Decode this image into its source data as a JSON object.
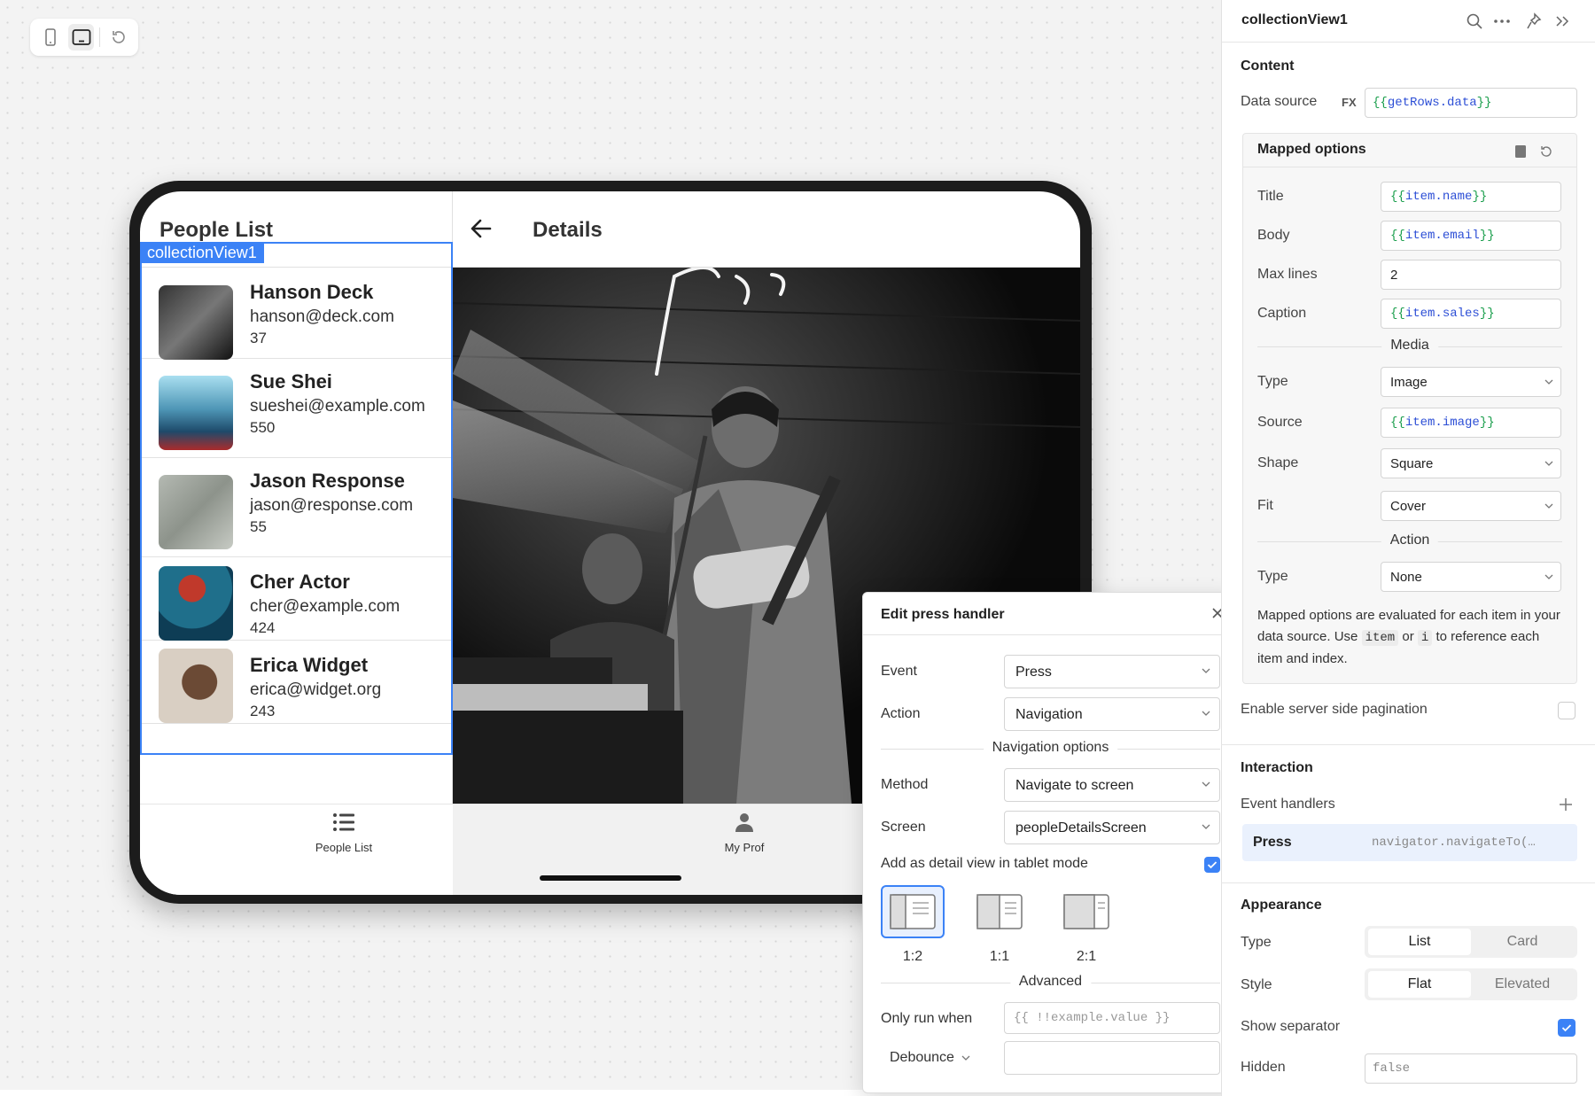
{
  "tablet": {
    "left_title": "People List",
    "right_title": "Details",
    "selection_tag": "collectionView1",
    "people": [
      {
        "name": "Hanson Deck",
        "email": "hanson@deck.com",
        "sales": "37"
      },
      {
        "name": "Sue Shei",
        "email": "sueshei@example.com",
        "sales": "550"
      },
      {
        "name": "Jason Response",
        "email": "jason@response.com",
        "sales": "55"
      },
      {
        "name": "Cher Actor",
        "email": "cher@example.com",
        "sales": "424"
      },
      {
        "name": "Erica Widget",
        "email": "erica@widget.org",
        "sales": "243"
      }
    ],
    "tabs": [
      {
        "label": "People List",
        "icon": "list-icon"
      },
      {
        "label": "My Prof",
        "icon": "person-icon"
      }
    ]
  },
  "popup": {
    "title": "Edit press handler",
    "event_label": "Event",
    "event_value": "Press",
    "action_label": "Action",
    "action_value": "Navigation",
    "nav_options_label": "Navigation options",
    "method_label": "Method",
    "method_value": "Navigate to screen",
    "screen_label": "Screen",
    "screen_value": "peopleDetailsScreen",
    "detail_view_label": "Add as detail view in tablet mode",
    "detail_view_checked": true,
    "layouts": [
      {
        "label": "1:2",
        "selected": true
      },
      {
        "label": "1:1",
        "selected": false
      },
      {
        "label": "2:1",
        "selected": false
      }
    ],
    "advanced_label": "Advanced",
    "only_run_label": "Only run when",
    "only_run_placeholder": "{{ !!example.value }}",
    "debounce_label": "Debounce",
    "debounce_value": ""
  },
  "panel": {
    "title": "collectionView1",
    "content_heading": "Content",
    "data_source_label": "Data source",
    "fx_label": "FX",
    "data_source_value": "getRows.data",
    "mapped_options_label": "Mapped options",
    "title_label": "Title",
    "title_value": "item.name",
    "body_label": "Body",
    "body_value": "item.email",
    "max_lines_label": "Max lines",
    "max_lines_value": "2",
    "caption_label": "Caption",
    "caption_value": "item.sales",
    "media_label": "Media",
    "media_type_label": "Type",
    "media_type_value": "Image",
    "source_label": "Source",
    "source_value": "item.image",
    "shape_label": "Shape",
    "shape_value": "Square",
    "fit_label": "Fit",
    "fit_value": "Cover",
    "action_label": "Action",
    "action_type_label": "Type",
    "action_type_value": "None",
    "note_1": "Mapped options are evaluated for each item in your data source. Use",
    "note_code_1": "item",
    "note_2": "or",
    "note_code_2": "i",
    "note_3": "to reference each item and index.",
    "server_pagination_label": "Enable server side pagination",
    "interaction_heading": "Interaction",
    "event_handlers_label": "Event handlers",
    "handler_event": "Press",
    "handler_action": "navigator.navigateTo(…",
    "appearance_heading": "Appearance",
    "type_label": "Type",
    "type_options": [
      "List",
      "Card"
    ],
    "style_label": "Style",
    "style_options": [
      "Flat",
      "Elevated"
    ],
    "show_separator_label": "Show separator",
    "hidden_label": "Hidden",
    "hidden_value": "false"
  },
  "colors": {
    "accent": "#3b82f6",
    "code_brace": "#1a9e4c",
    "code_value": "#2d4fd6"
  }
}
